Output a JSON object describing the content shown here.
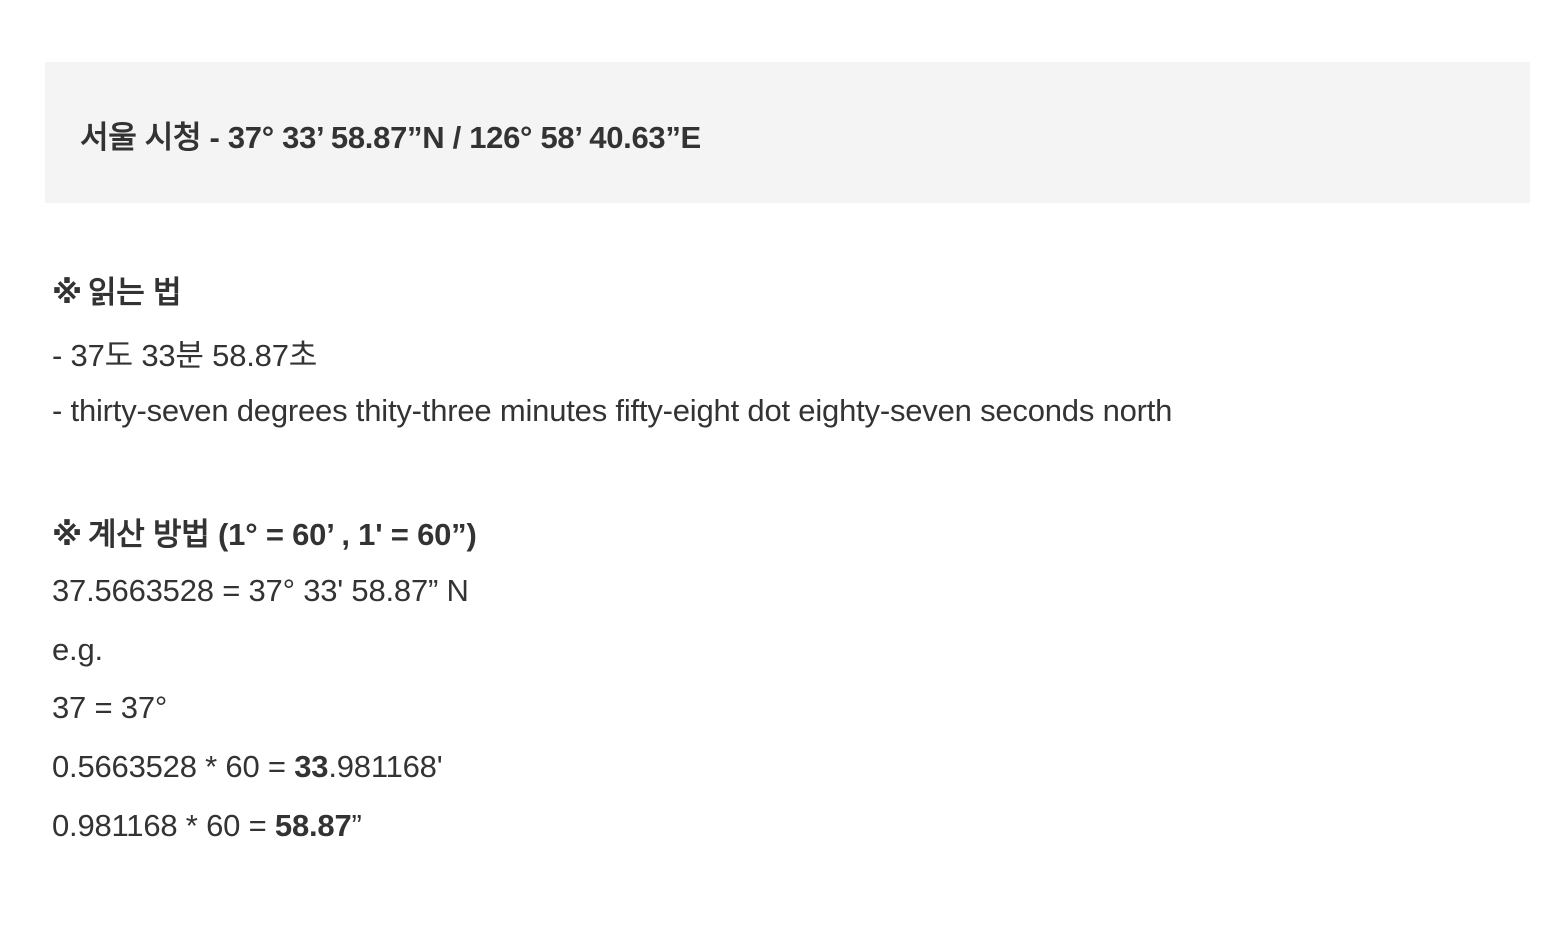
{
  "callout": {
    "text": "서울 시청 - 37° 33’ 58.87”N / 126° 58’ 40.63”E"
  },
  "reading": {
    "heading_mark": "※",
    "heading_label": "읽는 법",
    "korean": "- 37도 33분 58.87초",
    "english": "- thirty-seven degrees thity-three minutes fifty-eight dot eighty-seven seconds north"
  },
  "calc": {
    "heading_mark": "※",
    "heading_label": "계산 방법  (1° = 60’ ,  1' = 60”)",
    "result": "37.5663528 = 37° 33' 58.87” N",
    "eg": "e.g.",
    "step1": "37 = 37°",
    "step2_prefix": "0.5663528 * 60 = ",
    "step2_bold": "33",
    "step2_suffix": ".981168'",
    "step3_prefix": "0.981168 * 60 = ",
    "step3_bold": "58.87",
    "step3_suffix": "”"
  }
}
